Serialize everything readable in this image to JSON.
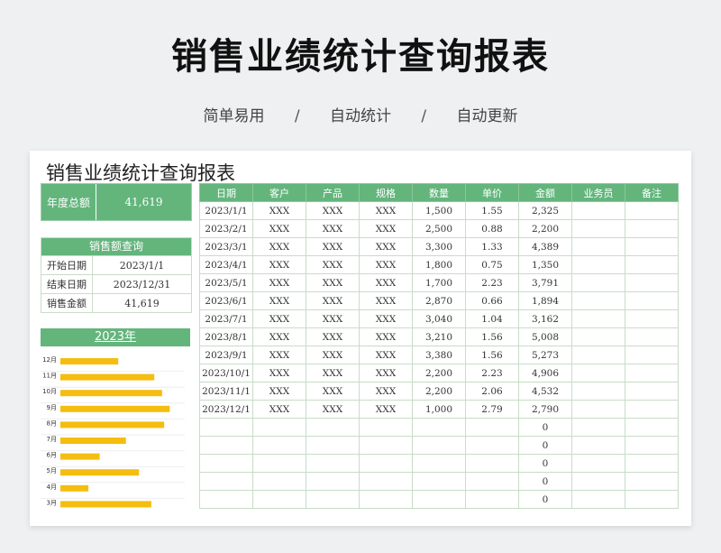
{
  "header": {
    "title": "销售业绩统计查询报表",
    "tags": [
      "简单易用",
      "自动统计",
      "自动更新"
    ],
    "separator": "/"
  },
  "sheet": {
    "title": "销售业绩统计查询报表",
    "year_total_label": "年度总额",
    "year_total_value": "41,619",
    "query": {
      "title": "销售额查询",
      "rows": [
        {
          "label": "开始日期",
          "value": "2023/1/1"
        },
        {
          "label": "结束日期",
          "value": "2023/12/31"
        },
        {
          "label": "销售金额",
          "value": "41,619"
        }
      ]
    },
    "chart_title": "2023年",
    "columns": [
      "日期",
      "客户",
      "产品",
      "规格",
      "数量",
      "单价",
      "金额",
      "业务员",
      "备注"
    ],
    "rows": [
      [
        "2023/1/1",
        "XXX",
        "XXX",
        "XXX",
        "1,500",
        "1.55",
        "2,325",
        "",
        ""
      ],
      [
        "2023/2/1",
        "XXX",
        "XXX",
        "XXX",
        "2,500",
        "0.88",
        "2,200",
        "",
        ""
      ],
      [
        "2023/3/1",
        "XXX",
        "XXX",
        "XXX",
        "3,300",
        "1.33",
        "4,389",
        "",
        ""
      ],
      [
        "2023/4/1",
        "XXX",
        "XXX",
        "XXX",
        "1,800",
        "0.75",
        "1,350",
        "",
        ""
      ],
      [
        "2023/5/1",
        "XXX",
        "XXX",
        "XXX",
        "1,700",
        "2.23",
        "3,791",
        "",
        ""
      ],
      [
        "2023/6/1",
        "XXX",
        "XXX",
        "XXX",
        "2,870",
        "0.66",
        "1,894",
        "",
        ""
      ],
      [
        "2023/7/1",
        "XXX",
        "XXX",
        "XXX",
        "3,040",
        "1.04",
        "3,162",
        "",
        ""
      ],
      [
        "2023/8/1",
        "XXX",
        "XXX",
        "XXX",
        "3,210",
        "1.56",
        "5,008",
        "",
        ""
      ],
      [
        "2023/9/1",
        "XXX",
        "XXX",
        "XXX",
        "3,380",
        "1.56",
        "5,273",
        "",
        ""
      ],
      [
        "2023/10/1",
        "XXX",
        "XXX",
        "XXX",
        "2,200",
        "2.23",
        "4,906",
        "",
        ""
      ],
      [
        "2023/11/1",
        "XXX",
        "XXX",
        "XXX",
        "2,200",
        "2.06",
        "4,532",
        "",
        ""
      ],
      [
        "2023/12/1",
        "XXX",
        "XXX",
        "XXX",
        "1,000",
        "2.79",
        "2,790",
        "",
        ""
      ],
      [
        "",
        "",
        "",
        "",
        "",
        "",
        "0",
        "",
        ""
      ],
      [
        "",
        "",
        "",
        "",
        "",
        "",
        "0",
        "",
        ""
      ],
      [
        "",
        "",
        "",
        "",
        "",
        "",
        "0",
        "",
        ""
      ],
      [
        "",
        "",
        "",
        "",
        "",
        "",
        "0",
        "",
        ""
      ],
      [
        "",
        "",
        "",
        "",
        "",
        "",
        "0",
        "",
        ""
      ]
    ]
  },
  "colors": {
    "accent_green": "#63b57c",
    "bar_yellow": "#f5bd0f"
  },
  "chart_data": {
    "type": "bar",
    "orientation": "horizontal",
    "title": "2023年",
    "categories": [
      "12月",
      "11月",
      "10月",
      "9月",
      "8月",
      "7月",
      "6月",
      "5月",
      "4月",
      "3月"
    ],
    "values": [
      2790,
      4532,
      4906,
      5273,
      5008,
      3162,
      1894,
      3791,
      1350,
      4389
    ],
    "xlim": [
      0,
      6000
    ],
    "grid": false,
    "legend": "none"
  }
}
